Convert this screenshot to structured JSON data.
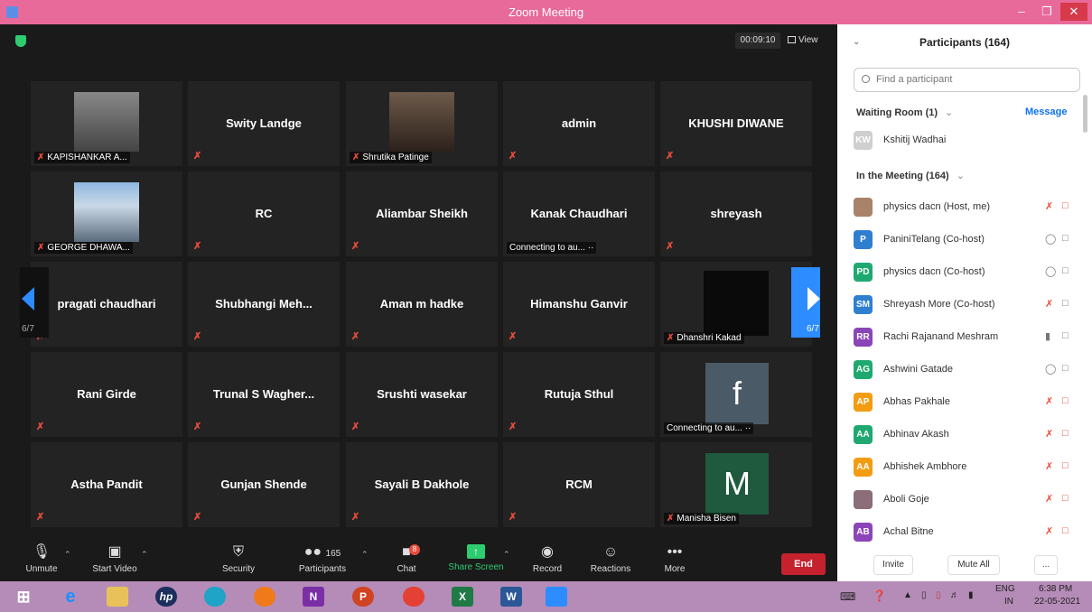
{
  "window": {
    "title": "Zoom Meeting"
  },
  "meeting": {
    "timer": "00:09:10",
    "view_label": "View",
    "page_left": "6/7",
    "page_right": "6/7"
  },
  "tiles": [
    {
      "name": "KAPISHANKAR A...",
      "kind": "photo"
    },
    {
      "name": "Swity Landge",
      "kind": "name"
    },
    {
      "name": "Shrutika Patinge",
      "kind": "photo"
    },
    {
      "name": "admin",
      "kind": "name"
    },
    {
      "name": "KHUSHI DIWANE",
      "kind": "name"
    },
    {
      "name": "GEORGE DHAWA...",
      "kind": "photo"
    },
    {
      "name": "RC",
      "kind": "name"
    },
    {
      "name": "Aliambar Sheikh",
      "kind": "name"
    },
    {
      "name": "Kanak Chaudhari",
      "kind": "name",
      "status": "Connecting to au..."
    },
    {
      "name": "shreyash",
      "kind": "name"
    },
    {
      "name": "pragati chaudhari",
      "kind": "name"
    },
    {
      "name": "Shubhangi  Meh...",
      "kind": "name"
    },
    {
      "name": "Aman m hadke",
      "kind": "name"
    },
    {
      "name": "Himanshu Ganvir",
      "kind": "name"
    },
    {
      "name": "Dhanshri Kakad",
      "kind": "dark"
    },
    {
      "name": "Rani Girde",
      "kind": "name"
    },
    {
      "name": "Trunal  S  Wagher...",
      "kind": "name"
    },
    {
      "name": "Srushti wasekar",
      "kind": "name"
    },
    {
      "name": "Rutuja Sthul",
      "kind": "name"
    },
    {
      "name": "Connecting to au...",
      "kind": "letter",
      "letter": "f"
    },
    {
      "name": "Astha Pandit",
      "kind": "name"
    },
    {
      "name": "Gunjan Shende",
      "kind": "name"
    },
    {
      "name": "Sayali B Dakhole",
      "kind": "name"
    },
    {
      "name": "RCM",
      "kind": "name"
    },
    {
      "name": "Manisha Bisen",
      "kind": "letter",
      "letter": "M"
    }
  ],
  "toolbar": {
    "unmute": "Unmute",
    "start_video": "Start Video",
    "security": "Security",
    "participants": "Participants",
    "participants_count": "165",
    "chat": "Chat",
    "chat_badge": "8",
    "share_screen": "Share Screen",
    "record": "Record",
    "reactions": "Reactions",
    "more": "More",
    "end": "End"
  },
  "panel": {
    "title": "Participants (164)",
    "search_placeholder": "Find a participant",
    "waiting_room": "Waiting Room (1)",
    "message": "Message",
    "waiting": [
      {
        "initials": "KW",
        "name": "Kshitij Wadhai",
        "color": "#cfcfcf"
      }
    ],
    "in_meeting": "In the Meeting (164)",
    "participants": [
      {
        "initials": "",
        "name": "physics dacn (Host, me)",
        "color": "#a9826a",
        "mic": "off",
        "cam": "off"
      },
      {
        "initials": "P",
        "name": "PaniniTelang (Co-host)",
        "color": "#2f7fd1",
        "mic": "on",
        "cam": "on"
      },
      {
        "initials": "PD",
        "name": "physics dacn (Co-host)",
        "color": "#1fa971",
        "mic": "on",
        "cam": "on"
      },
      {
        "initials": "SM",
        "name": "Shreyash More (Co-host)",
        "color": "#2f7fd1",
        "mic": "off",
        "cam": "on"
      },
      {
        "initials": "RR",
        "name": "Rachi  Rajanand Meshram",
        "color": "#8b45b8",
        "mic": "active",
        "cam": "on"
      },
      {
        "initials": "AG",
        "name": "Ashwini Gatade",
        "color": "#1fa971",
        "mic": "on",
        "cam": "on"
      },
      {
        "initials": "AP",
        "name": "Abhas Pakhale",
        "color": "#f39c12",
        "mic": "off",
        "cam": "off"
      },
      {
        "initials": "AA",
        "name": "Abhinav Akash",
        "color": "#1fa971",
        "mic": "off",
        "cam": "off"
      },
      {
        "initials": "AA",
        "name": "Abhishek Ambhore",
        "color": "#f39c12",
        "mic": "off",
        "cam": "off"
      },
      {
        "initials": "",
        "name": "Aboli Goje",
        "color": "#8c6d7a",
        "mic": "off",
        "cam": "off"
      },
      {
        "initials": "AB",
        "name": "Achal Bitne",
        "color": "#8b45b8",
        "mic": "off",
        "cam": "off"
      }
    ],
    "invite": "Invite",
    "mute_all": "Mute All",
    "more": "..."
  },
  "taskbar": {
    "lang": "ENG",
    "region": "IN",
    "time": "6:38 PM",
    "date": "22-05-2021"
  }
}
